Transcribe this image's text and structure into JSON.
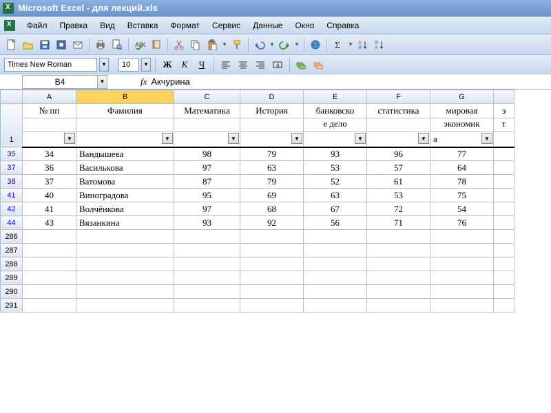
{
  "title": "Microsoft Excel - для лекций.xls",
  "menu": [
    "Файл",
    "Правка",
    "Вид",
    "Вставка",
    "Формат",
    "Сервис",
    "Данные",
    "Окно",
    "Справка"
  ],
  "font_name": "Times New Roman",
  "font_size": "10",
  "bold_label": "Ж",
  "italic_label": "К",
  "underline_label": "Ч",
  "namebox": "B4",
  "fx_label": "fx",
  "formula_value": "Акчурина",
  "col_letters": [
    "A",
    "B",
    "C",
    "D",
    "E",
    "F",
    "G"
  ],
  "headers": {
    "A": "№ пп",
    "B": "Фамилия",
    "C": "Математика",
    "D": "История",
    "E": "банковско",
    "E2": "е дело",
    "F": "статистика",
    "G": "мировая",
    "G2": "экономик",
    "G3": "а"
  },
  "filter_row_label": "1",
  "rows": [
    {
      "rn": "35",
      "n": "34",
      "fam": "Вандышева",
      "c": "98",
      "d": "79",
      "e": "93",
      "f": "96",
      "g": "77"
    },
    {
      "rn": "37",
      "n": "36",
      "fam": "Василькова",
      "c": "97",
      "d": "63",
      "e": "53",
      "f": "57",
      "g": "64"
    },
    {
      "rn": "38",
      "n": "37",
      "fam": "Ватомова",
      "c": "87",
      "d": "79",
      "e": "52",
      "f": "61",
      "g": "78"
    },
    {
      "rn": "41",
      "n": "40",
      "fam": "Виноградова",
      "c": "95",
      "d": "69",
      "e": "63",
      "f": "53",
      "g": "75"
    },
    {
      "rn": "42",
      "n": "41",
      "fam": "Волчёнкова",
      "c": "97",
      "d": "68",
      "e": "67",
      "f": "72",
      "g": "54"
    },
    {
      "rn": "44",
      "n": "43",
      "fam": "Вязанкина",
      "c": "93",
      "d": "92",
      "e": "56",
      "f": "71",
      "g": "76"
    }
  ],
  "empty_rows": [
    "286",
    "287",
    "288",
    "289",
    "290",
    "291"
  ],
  "chart_data": {
    "type": "table",
    "title": "Filtered student scores",
    "columns": [
      "№ пп",
      "Фамилия",
      "Математика",
      "История",
      "банковское дело",
      "статистика",
      "мировая экономика"
    ],
    "records": [
      [
        34,
        "Вандышева",
        98,
        79,
        93,
        96,
        77
      ],
      [
        36,
        "Василькова",
        97,
        63,
        53,
        57,
        64
      ],
      [
        37,
        "Ватомова",
        87,
        79,
        52,
        61,
        78
      ],
      [
        40,
        "Виноградова",
        95,
        69,
        63,
        53,
        75
      ],
      [
        41,
        "Волчёнкова",
        97,
        68,
        67,
        72,
        54
      ],
      [
        43,
        "Вязанкина",
        93,
        92,
        56,
        71,
        76
      ]
    ]
  }
}
